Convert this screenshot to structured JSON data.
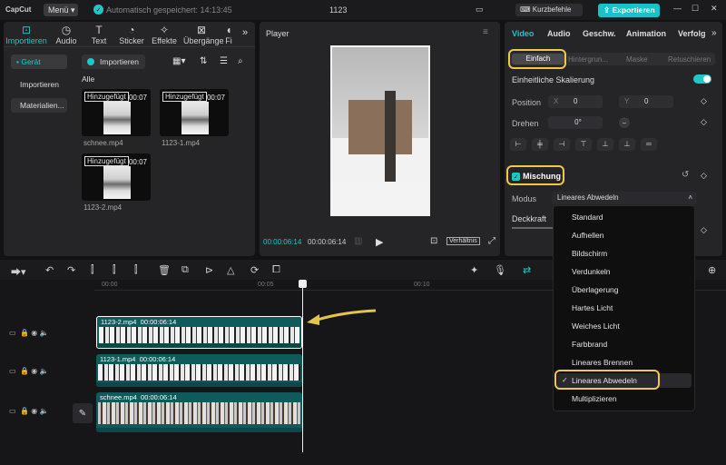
{
  "titlebar": {
    "logo": "CapCut",
    "menu": "Menü",
    "autosave": "Automatisch gespeichert: 14:13:45",
    "project": "1123",
    "shortcuts": "Kurzbefehle",
    "export": "Exportieren"
  },
  "media": {
    "tabs": [
      {
        "label": "Importieren",
        "icon": "import-icon",
        "active": true
      },
      {
        "label": "Audio",
        "icon": "audio-icon"
      },
      {
        "label": "Text",
        "icon": "text-icon"
      },
      {
        "label": "Sticker",
        "icon": "sticker-icon"
      },
      {
        "label": "Effekte",
        "icon": "effects-icon"
      },
      {
        "label": "Übergänge",
        "icon": "transitions-icon"
      },
      {
        "label": "Fi",
        "icon": "filter-icon"
      }
    ],
    "sidebar": [
      "• Gerät",
      "Importieren",
      "Materialien..."
    ],
    "import_button": "Importieren",
    "section": "Alle",
    "items": [
      {
        "badge": "Hinzugefügt",
        "dur": "00:07",
        "name": "schnee.mp4"
      },
      {
        "badge": "Hinzugefügt",
        "dur": "00:07",
        "name": "1123-1.mp4"
      },
      {
        "badge": "Hinzugefügt",
        "dur": "00:07",
        "name": "1123-2.mp4"
      }
    ]
  },
  "player": {
    "title": "Player",
    "current": "00:00:06:14",
    "total": "00:00:06:14",
    "ratio": "Verhältnis"
  },
  "props": {
    "tabs": [
      "Video",
      "Audio",
      "Geschw.",
      "Animation",
      "Verfolg"
    ],
    "subtabs": [
      "Einfach",
      "Hintergrun...",
      "Maske",
      "Retuschieren"
    ],
    "scale_label": "Einheitliche Skalierung",
    "position_label": "Position",
    "x_label": "X",
    "x_value": "0",
    "y_label": "Y",
    "y_value": "0",
    "rotate_label": "Drehen",
    "rotate_value": "0°",
    "blend_label": "Mischung",
    "mode_label": "Modus",
    "mode_value": "Lineares Abwedeln",
    "opacity_label": "Deckkraft"
  },
  "blend_options": [
    "Standard",
    "Aufhellen",
    "Bildschirm",
    "Verdunkeln",
    "Überlagerung",
    "Hartes Licht",
    "Weiches Licht",
    "Farbbrand",
    "Lineares Brennen",
    "Lineares Abwedeln",
    "Multiplizieren"
  ],
  "timeline": {
    "ticks": [
      "00:00",
      "00:05",
      "00:10"
    ],
    "clips": [
      {
        "name": "1123-2.mp4",
        "dur": "00:00:06:14"
      },
      {
        "name": "1123-1.mp4",
        "dur": "00:00:06:14"
      },
      {
        "name": "schnee.mp4",
        "dur": "00:00:06:14"
      }
    ]
  },
  "colors": {
    "accent": "#1ec8c8",
    "highlight": "#f0c84a",
    "export": "#17c3c8"
  }
}
